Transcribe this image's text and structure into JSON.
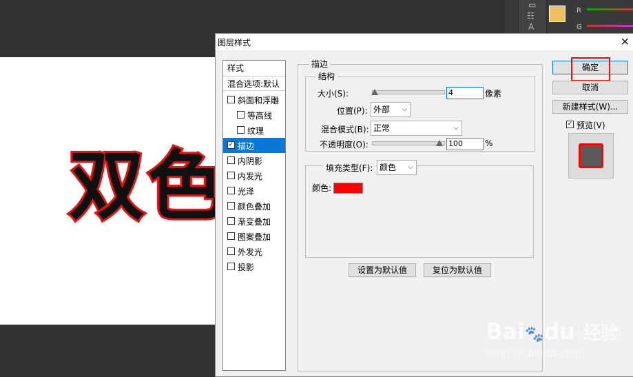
{
  "canvas": {
    "art_text": "双色"
  },
  "colors": {
    "accent": "#0a78d7",
    "stroke": "#ff0000",
    "highlight": "#e81212"
  },
  "channels": [
    "R",
    "G"
  ],
  "dialog": {
    "title": "图层样式",
    "style_list": {
      "header": "样式",
      "blend": "混合选项:默认",
      "items": [
        {
          "label": "斜面和浮雕",
          "checked": false
        },
        {
          "label": "等高线",
          "checked": false
        },
        {
          "label": "纹理",
          "checked": false
        },
        {
          "label": "描边",
          "checked": true
        },
        {
          "label": "内阴影",
          "checked": false
        },
        {
          "label": "内发光",
          "checked": false
        },
        {
          "label": "光泽",
          "checked": false
        },
        {
          "label": "颜色叠加",
          "checked": false
        },
        {
          "label": "渐变叠加",
          "checked": false
        },
        {
          "label": "图案叠加",
          "checked": false
        },
        {
          "label": "外发光",
          "checked": false
        },
        {
          "label": "投影",
          "checked": false
        }
      ]
    },
    "stroke": {
      "group_title": "描边",
      "structure_title": "结构",
      "size_label": "大小(S):",
      "size_value": "4",
      "size_unit": "像素",
      "position_label": "位置(P):",
      "position_value": "外部",
      "blend_label": "混合模式(B):",
      "blend_value": "正常",
      "opacity_label": "不透明度(O):",
      "opacity_value": "100",
      "opacity_unit": "%",
      "fill_type_label": "填充类型(F):",
      "fill_type_value": "颜色",
      "color_label": "颜色:",
      "make_default": "设置为默认值",
      "reset_default": "复位为默认值"
    },
    "buttons": {
      "ok": "确定",
      "cancel": "取消",
      "new_style": "新建样式(W)...",
      "preview_label": "预览(V)",
      "preview_checked": true
    }
  },
  "watermark": {
    "text1": "Bai",
    "text2": "du",
    "text3": "经验",
    "text4": "jingyan.baidu.com"
  }
}
